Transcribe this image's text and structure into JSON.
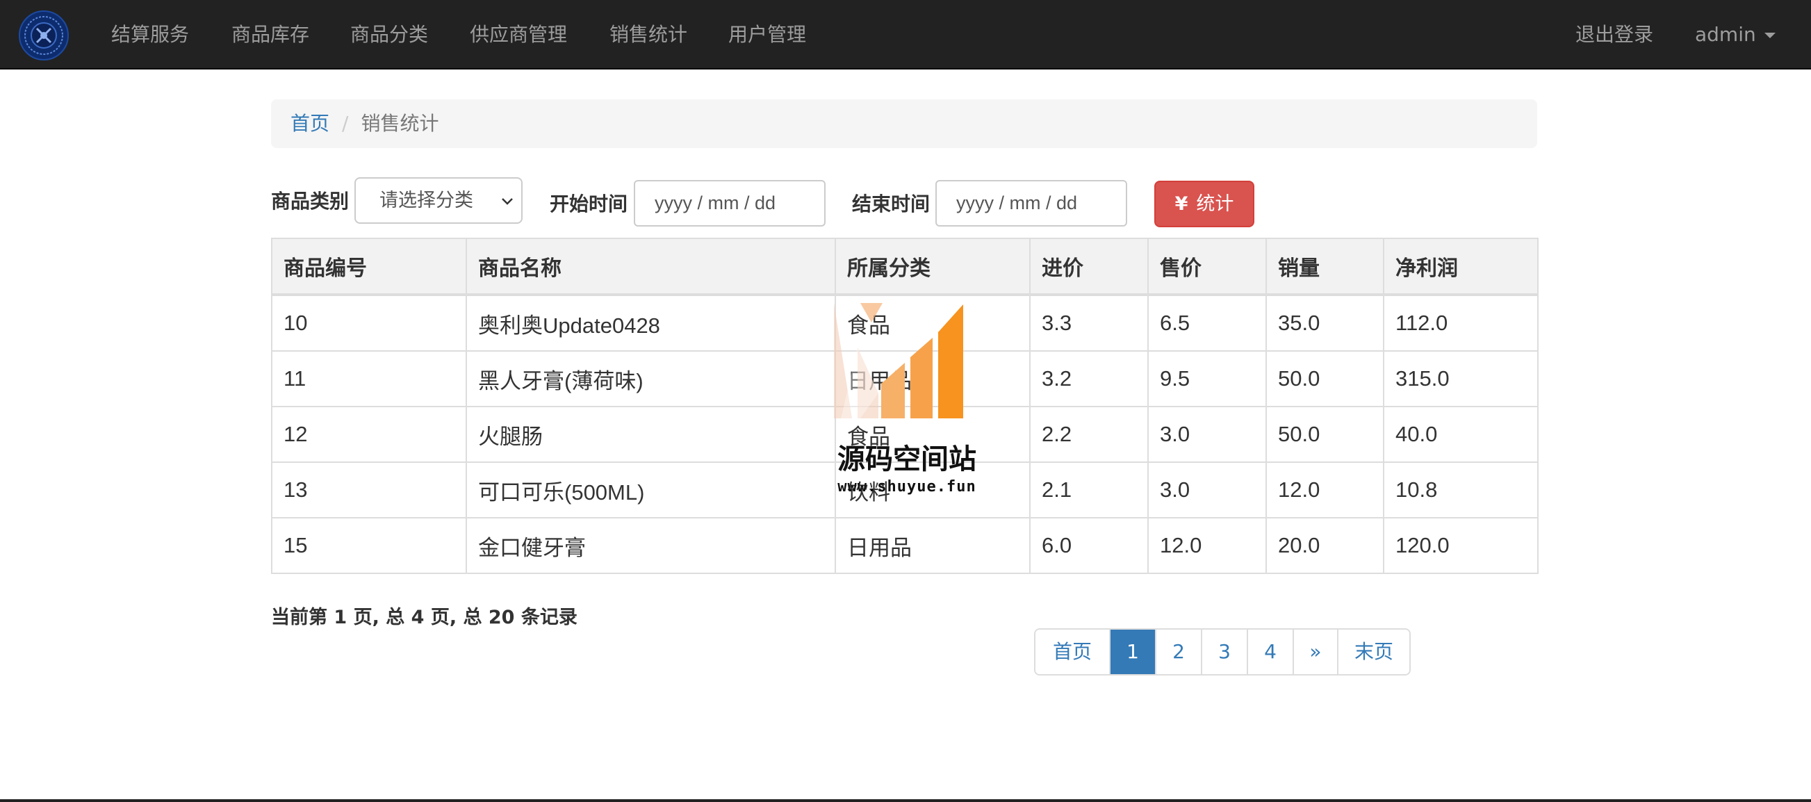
{
  "navbar": {
    "items": [
      {
        "label": "结算服务"
      },
      {
        "label": "商品库存"
      },
      {
        "label": "商品分类"
      },
      {
        "label": "供应商管理"
      },
      {
        "label": "销售统计"
      },
      {
        "label": "用户管理"
      }
    ],
    "logout_label": "退出登录",
    "user_label": "admin"
  },
  "breadcrumb": {
    "home": "首页",
    "separator": "/",
    "current": "销售统计"
  },
  "filters": {
    "category_label": "商品类别",
    "category_value": "请选择分类",
    "start_label": "开始时间",
    "start_value": "yyyy / mm / dd",
    "end_label": "结束时间",
    "end_value": "yyyy / mm / dd",
    "submit_icon": "¥",
    "submit_label": "统计"
  },
  "table": {
    "headers": [
      "商品编号",
      "商品名称",
      "所属分类",
      "进价",
      "售价",
      "销量",
      "净利润"
    ],
    "rows": [
      [
        "10",
        "奥利奥Update0428",
        "食品",
        "3.3",
        "6.5",
        "35.0",
        "112.0"
      ],
      [
        "11",
        "黑人牙膏(薄荷味)",
        "日用品",
        "3.2",
        "9.5",
        "50.0",
        "315.0"
      ],
      [
        "12",
        "火腿肠",
        "食品",
        "2.2",
        "3.0",
        "50.0",
        "40.0"
      ],
      [
        "13",
        "可口可乐(500ML)",
        "饮料",
        "2.1",
        "3.0",
        "12.0",
        "10.8"
      ],
      [
        "15",
        "金口健牙膏",
        "日用品",
        "6.0",
        "12.0",
        "20.0",
        "120.0"
      ]
    ]
  },
  "watermark": {
    "text": "源码空间站",
    "url": "www.shuyue.fun"
  },
  "summary": "当前第 1 页, 总 4 页, 总 20 条记录",
  "pagination": {
    "first": "首页",
    "pages": [
      "1",
      "2",
      "3",
      "4"
    ],
    "next": "»",
    "last": "末页",
    "current": "1"
  },
  "colors": {
    "navbar_bg": "#222222",
    "link": "#337ab7",
    "danger": "#d9534f",
    "watermark_orange": "#f7931e"
  }
}
